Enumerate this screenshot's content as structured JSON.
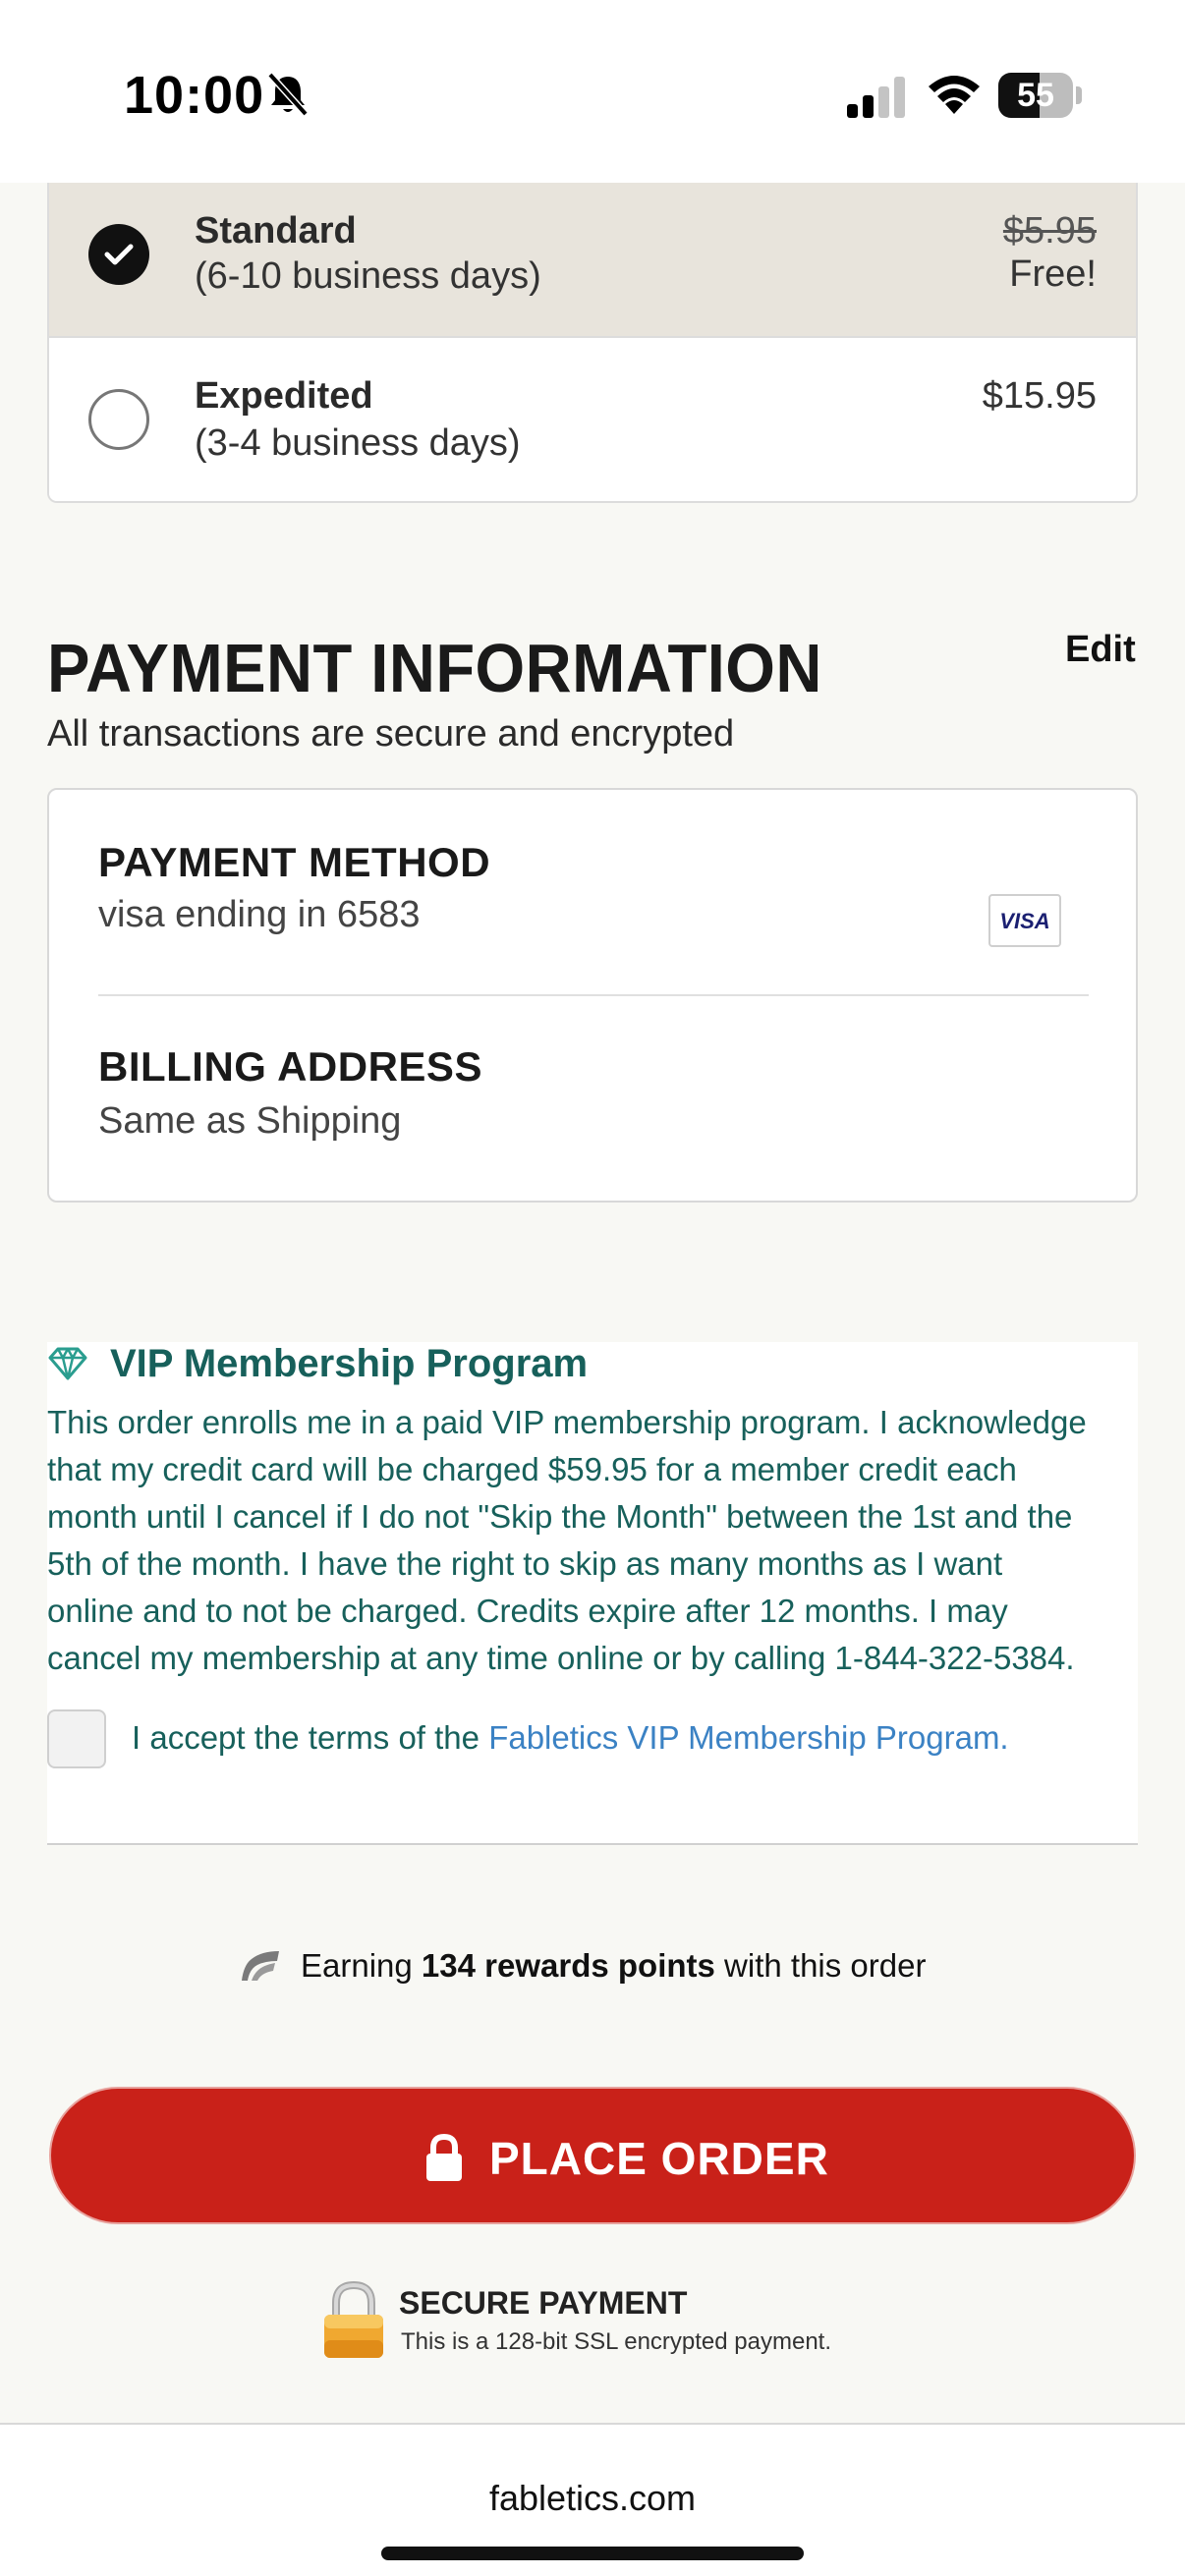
{
  "status_bar": {
    "time": "10:00",
    "battery_level": "55"
  },
  "shipping": {
    "options": [
      {
        "title": "Standard",
        "subtitle": "(6-10 business days)",
        "original_price": "$5.95",
        "price": "Free!",
        "selected": true
      },
      {
        "title": "Expedited",
        "subtitle": "(3-4 business days)",
        "price": "$15.95",
        "selected": false
      }
    ]
  },
  "payment": {
    "heading": "PAYMENT INFORMATION",
    "edit_label": "Edit",
    "secure_note": "All transactions are secure and encrypted",
    "method_label": "PAYMENT METHOD",
    "method_value": "visa ending in 6583",
    "card_brand": "VISA",
    "billing_label": "BILLING ADDRESS",
    "billing_value": "Same as Shipping"
  },
  "vip": {
    "title": "VIP Membership Program",
    "lines": [
      "This order enrolls me in a paid VIP membership program. I acknowledge",
      "that my credit card will be charged $59.95 for a member credit each",
      "month until I cancel if I do not \"Skip the Month\" between the 1st and the",
      "5th of the month. I have the right to skip as many months as I want",
      "online and to not be charged. Credits expire after 12 months. I may",
      "cancel my membership at any time online or by calling 1-844-322-5384."
    ],
    "accept_prefix": "I accept the terms of the ",
    "accept_link": "Fabletics VIP Membership Program.",
    "accepted": false
  },
  "rewards": {
    "prefix": "Earning ",
    "points": "134 rewards points",
    "suffix": " with this order"
  },
  "place_order_label": "PLACE ORDER",
  "secure_payment": {
    "title": "SECURE PAYMENT",
    "subtitle": "This is a 128-bit SSL encrypted payment."
  },
  "footer": {
    "url": "fabletics.com"
  },
  "colors": {
    "brand_red": "#c92119",
    "vip_teal": "#17605b",
    "link_blue": "#3b82c4",
    "selected_bg": "#e8e4dc"
  }
}
